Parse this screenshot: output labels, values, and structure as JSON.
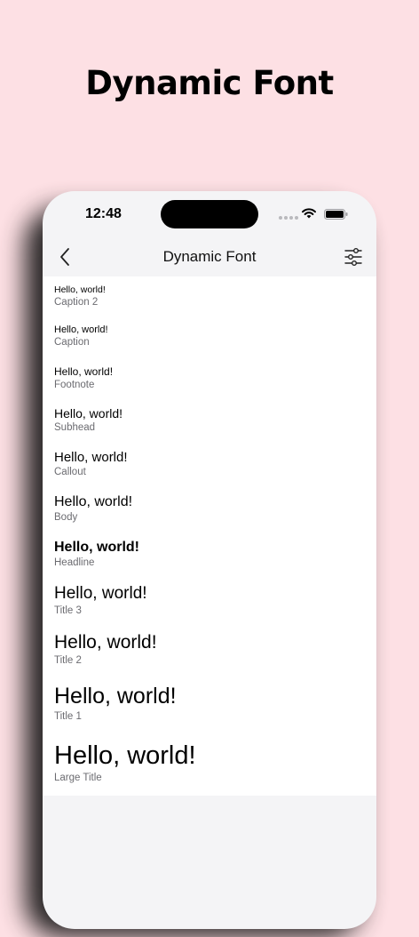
{
  "promo": {
    "headline": "Dynamic Font"
  },
  "status_bar": {
    "time": "12:48"
  },
  "nav": {
    "title": "Dynamic Font"
  },
  "rows": [
    {
      "sample": "Hello, world!",
      "style": "Caption 2"
    },
    {
      "sample": "Hello, world!",
      "style": "Caption"
    },
    {
      "sample": "Hello, world!",
      "style": "Footnote"
    },
    {
      "sample": "Hello, world!",
      "style": "Subhead"
    },
    {
      "sample": "Hello, world!",
      "style": "Callout"
    },
    {
      "sample": "Hello, world!",
      "style": "Body"
    },
    {
      "sample": "Hello, world!",
      "style": "Headline"
    },
    {
      "sample": "Hello, world!",
      "style": "Title 3"
    },
    {
      "sample": "Hello, world!",
      "style": "Title 2"
    },
    {
      "sample": "Hello, world!",
      "style": "Title 1"
    },
    {
      "sample": "Hello, world!",
      "style": "Large Title"
    }
  ],
  "colors": {
    "background": "#fde0e4",
    "phone_chrome": "#f4f4f6",
    "list_background": "#ffffff",
    "secondary_text": "#6b6b70"
  },
  "icons": {
    "back": "chevron-left-icon",
    "settings": "sliders-icon",
    "wifi": "wifi-icon",
    "battery": "battery-icon"
  }
}
